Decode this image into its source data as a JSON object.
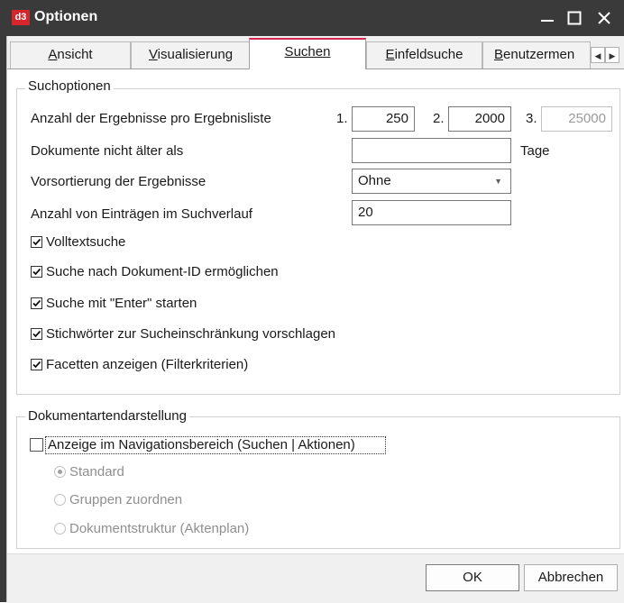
{
  "window": {
    "title": "Optionen",
    "app_icon_text": "d3",
    "controls": [
      "minimize-icon",
      "maximize-icon",
      "close-icon"
    ],
    "accent_color": "#d6264f",
    "titlebar_color": "#3a3a3a"
  },
  "tabs": [
    {
      "label": "Ansicht",
      "underline_char": "A",
      "rest": "nsicht",
      "active": false
    },
    {
      "label": "Visualisierung",
      "underline_char": "V",
      "rest": "isualisierung",
      "active": false
    },
    {
      "label": "Suchen",
      "underline_char": "S",
      "rest": "uchen",
      "active": true
    },
    {
      "label": "Einfeldsuche",
      "underline_char": "E",
      "rest": "infeldsuche",
      "active": false
    },
    {
      "label": "Benutzermen",
      "underline_char": "B",
      "rest": "enutzermen",
      "active": false
    }
  ],
  "tab_scroll": {
    "left_icon": "chevron-left-icon",
    "right_icon": "chevron-right-icon"
  },
  "search_options": {
    "legend": "Suchoptionen",
    "results_per_list": {
      "label": "Anzahl der Ergebnisse pro Ergebnisliste",
      "entries": [
        {
          "index": "1.",
          "value": "250"
        },
        {
          "index": "2.",
          "value": "2000"
        },
        {
          "index": "3.",
          "value": "25000"
        }
      ]
    },
    "not_older_than": {
      "label": "Dokumente nicht älter als",
      "value": "",
      "unit": "Tage"
    },
    "presort": {
      "label": "Vorsortierung der Ergebnisse",
      "value": "Ohne"
    },
    "history_entries": {
      "label": "Anzahl von Einträgen im Suchverlauf",
      "value": "20"
    },
    "checkboxes": [
      {
        "label": "Volltextsuche",
        "checked": true
      },
      {
        "label": "Suche nach Dokument-ID ermöglichen",
        "checked": true
      },
      {
        "label": "Suche mit \"Enter\" starten",
        "checked": true
      },
      {
        "label": "Stichwörter zur Sucheinschränkung vorschlagen",
        "checked": true
      },
      {
        "label": "Facetten anzeigen (Filterkriterien)",
        "checked": true
      }
    ]
  },
  "doc_types": {
    "legend": "Dokumentartendarstellung",
    "nav_checkbox": {
      "label": "Anzeige im Navigationsbereich (Suchen | Aktionen)",
      "checked": false
    },
    "radios": [
      {
        "label": "Standard",
        "selected": true
      },
      {
        "label": "Gruppen zuordnen",
        "selected": false
      },
      {
        "label": "Dokumentstruktur (Aktenplan)",
        "selected": false
      }
    ]
  },
  "buttons": {
    "ok": "OK",
    "cancel": "Abbrechen"
  }
}
